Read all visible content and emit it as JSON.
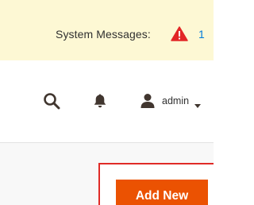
{
  "system_messages": {
    "label": "System Messages:",
    "count": "1",
    "warning_icon": "warning-icon",
    "warning_color": "#e22626",
    "count_color": "#007bdb",
    "banner_bg": "#fdf8d4"
  },
  "header": {
    "search_icon": "search-icon",
    "notifications_icon": "bell-icon",
    "user": {
      "icon": "user-icon",
      "name": "admin",
      "caret_icon": "caret-down-icon"
    }
  },
  "page_actions": {
    "add_new_label": "Add New",
    "button_color": "#eb5202",
    "highlight_color": "#e02b27"
  }
}
